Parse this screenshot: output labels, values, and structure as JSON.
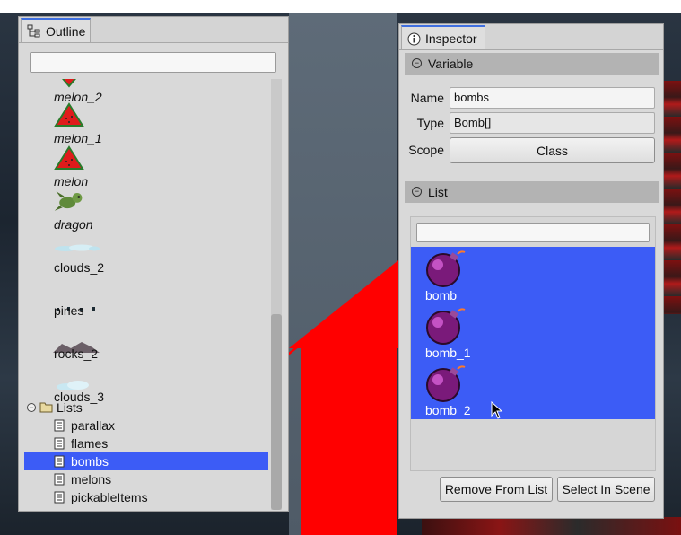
{
  "outline": {
    "tab_label": "Outline",
    "search": {
      "value": "",
      "placeholder": ""
    },
    "objects": [
      {
        "name": "melon_2",
        "icon": "melon-slice-icon"
      },
      {
        "name": "melon_1",
        "icon": "melon-slice-icon"
      },
      {
        "name": "melon",
        "icon": "melon-slice-icon"
      },
      {
        "name": "dragon",
        "icon": "dragon-sprite-icon"
      },
      {
        "name": "clouds_2",
        "icon": "clouds-sprite-icon"
      },
      {
        "name": "pines",
        "icon": "pines-sprite-icon"
      },
      {
        "name": "rocks_2",
        "icon": "rocks-sprite-icon"
      },
      {
        "name": "clouds_3",
        "icon": "clouds-sprite-icon"
      }
    ],
    "lists_folder": "Lists",
    "lists": [
      "parallax",
      "flames",
      "bombs",
      "melons",
      "pickableItems"
    ],
    "selected_list": "bombs"
  },
  "inspector": {
    "tab_label": "Inspector",
    "variable_section": {
      "title": "Variable",
      "name_label": "Name",
      "name_value": "bombs",
      "type_label": "Type",
      "type_value": "Bomb[]",
      "scope_label": "Scope",
      "scope_value": "Class"
    },
    "list_section": {
      "title": "List",
      "search": {
        "value": "",
        "placeholder": ""
      },
      "items": [
        "bomb",
        "bomb_1",
        "bomb_2"
      ],
      "remove_button": "Remove From List",
      "select_button": "Select In Scene"
    }
  },
  "colors": {
    "selection": "#3c5cf6",
    "tab_accent": "#3f6fe0",
    "connector": "#ff0000"
  }
}
